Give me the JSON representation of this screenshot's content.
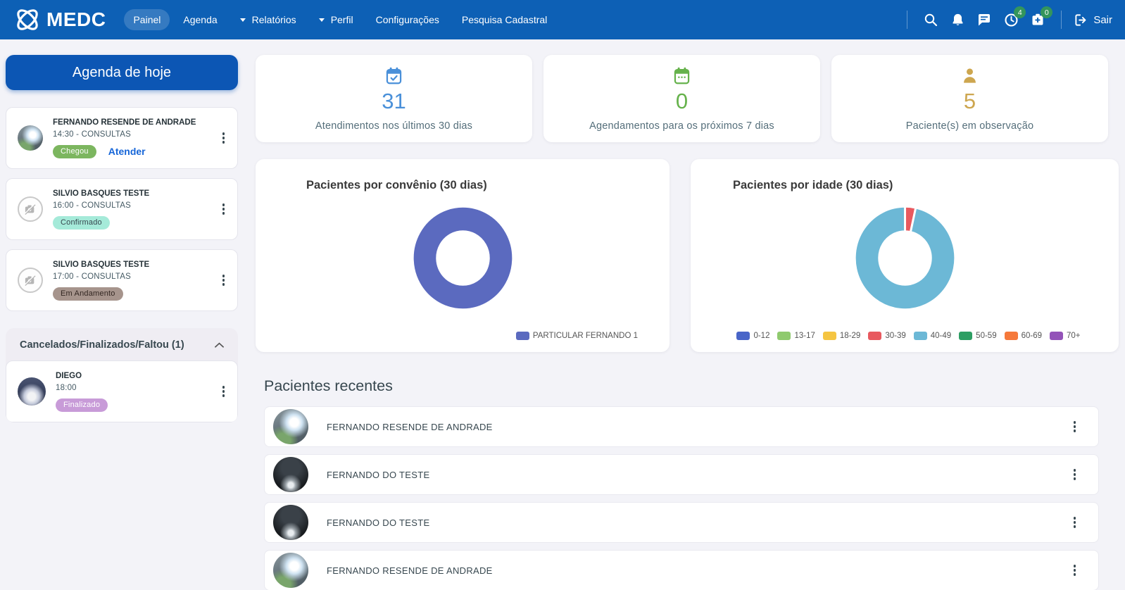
{
  "navbar": {
    "brand": "MEDC",
    "items": [
      {
        "label": "Painel",
        "active": true
      },
      {
        "label": "Agenda"
      },
      {
        "label": "Relatórios",
        "caret": true
      },
      {
        "label": "Perfil",
        "caret": true
      },
      {
        "label": "Configurações"
      },
      {
        "label": "Pesquisa Cadastral"
      }
    ],
    "badges": {
      "clock": "4",
      "medbox": "0"
    },
    "logout_label": "Sair",
    "color": "#0d60b5"
  },
  "sidebar": {
    "agenda_button": "Agenda de hoje",
    "appointments": [
      {
        "name": "FERNANDO RESENDE DE ANDRADE",
        "time": "14:30 - CONSULTAS",
        "avatar": "person-light",
        "badge": {
          "label": "Chegou",
          "bg": "#7cb65f",
          "fg": "#ffffff"
        },
        "action": "Atender"
      },
      {
        "name": "SILVIO BASQUES TESTE",
        "time": "16:00 - CONSULTAS",
        "avatar": "camera-placeholder",
        "badge": {
          "label": "Confirmado",
          "bg": "#a5ead9",
          "fg": "#37474f"
        }
      },
      {
        "name": "SILVIO BASQUES TESTE",
        "time": "17:00 - CONSULTAS",
        "avatar": "camera-placeholder",
        "badge": {
          "label": "Em Andamento",
          "bg": "#a6948c",
          "fg": "#332722"
        }
      }
    ],
    "cancelled_header": "Cancelados/Finalizados/Faltou (1)",
    "cancelled": [
      {
        "name": "DIEGO",
        "time": "18:00",
        "avatar": "soccer",
        "badge": {
          "label": "Finalizado",
          "bg": "#c89bd8",
          "fg": "#ffffff"
        }
      }
    ]
  },
  "stats": [
    {
      "value": "31",
      "label": "Atendimentos nos últimos 30 dias",
      "color": "#4a90d9",
      "icon": "calendar-check"
    },
    {
      "value": "0",
      "label": "Agendamentos para os próximos 7 dias",
      "color": "#66b24c",
      "icon": "calendar"
    },
    {
      "value": "5",
      "label": "Paciente(s) em observação",
      "color": "#cda64f",
      "icon": "person"
    }
  ],
  "chart_data": [
    {
      "type": "doughnut",
      "title": "Pacientes por convênio (30 dias)",
      "labels": [
        "PARTICULAR FERNANDO 1"
      ],
      "values": [
        1
      ],
      "colors": [
        "#5b6abf"
      ],
      "legend_position": "bottom-right"
    },
    {
      "type": "doughnut",
      "title": "Pacientes por idade (30 dias)",
      "labels": [
        "0-12",
        "13-17",
        "18-29",
        "30-39",
        "40-49",
        "50-59",
        "60-69",
        "70+"
      ],
      "values": [
        0,
        0,
        0,
        1,
        28,
        0,
        0,
        0
      ],
      "colors": [
        "#4965c8",
        "#8fca6e",
        "#f5c542",
        "#e8595f",
        "#6cb8d6",
        "#2d9e63",
        "#f5793b",
        "#9353b8"
      ],
      "legend_position": "bottom-center"
    }
  ],
  "recent": {
    "title": "Pacientes recentes",
    "patients": [
      {
        "name": "FERNANDO RESENDE DE ANDRADE",
        "avatar": "person-light"
      },
      {
        "name": "FERNANDO DO TESTE",
        "avatar": "dark-logo"
      },
      {
        "name": "FERNANDO DO TESTE",
        "avatar": "dark-logo"
      },
      {
        "name": "FERNANDO RESENDE DE ANDRADE",
        "avatar": "person-light"
      }
    ]
  }
}
